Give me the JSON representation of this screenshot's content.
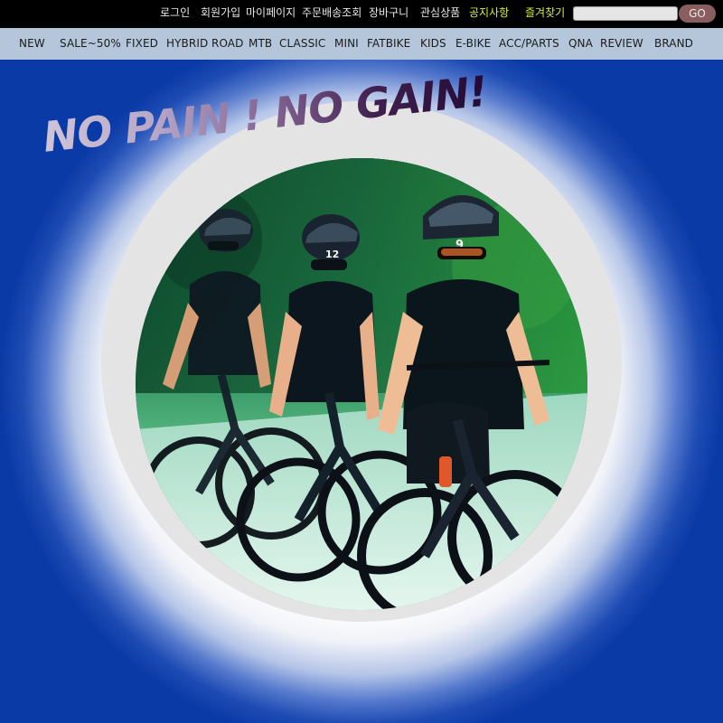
{
  "topbar": {
    "links": [
      {
        "label": "로그인"
      },
      {
        "label": "회원가입"
      },
      {
        "label": "마이페이지"
      },
      {
        "label": "주문배송조회"
      },
      {
        "label": "장바구니"
      },
      {
        "label": "관심상품"
      },
      {
        "label": "공지사항",
        "highlight": true
      },
      {
        "label": "즐겨찾기",
        "highlight": true
      }
    ],
    "search": {
      "value": "",
      "placeholder": ""
    },
    "go_label": "GO"
  },
  "nav": {
    "items": [
      {
        "label": "NEW"
      },
      {
        "label": "SALE~50%"
      },
      {
        "label": "FIXED"
      },
      {
        "label": "HYBRID"
      },
      {
        "label": "ROAD"
      },
      {
        "label": "MTB"
      },
      {
        "label": "CLASSIC"
      },
      {
        "label": "MINI"
      },
      {
        "label": "FATBIKE"
      },
      {
        "label": "KIDS"
      },
      {
        "label": "E-BIKE"
      },
      {
        "label": "ACC/PARTS"
      },
      {
        "label": "QNA"
      },
      {
        "label": "REVIEW"
      },
      {
        "label": "BRAND"
      }
    ]
  },
  "hero": {
    "slogan": "NO PAIN ! NO GAIN!",
    "rider_numbers": [
      "12",
      "9"
    ]
  },
  "colors": {
    "page_background": "#0a3aa6",
    "topbar_background": "#000000",
    "nav_background": "#b5c6db",
    "highlight_link": "#d8ee3a",
    "go_button": "#8a5e5e"
  }
}
